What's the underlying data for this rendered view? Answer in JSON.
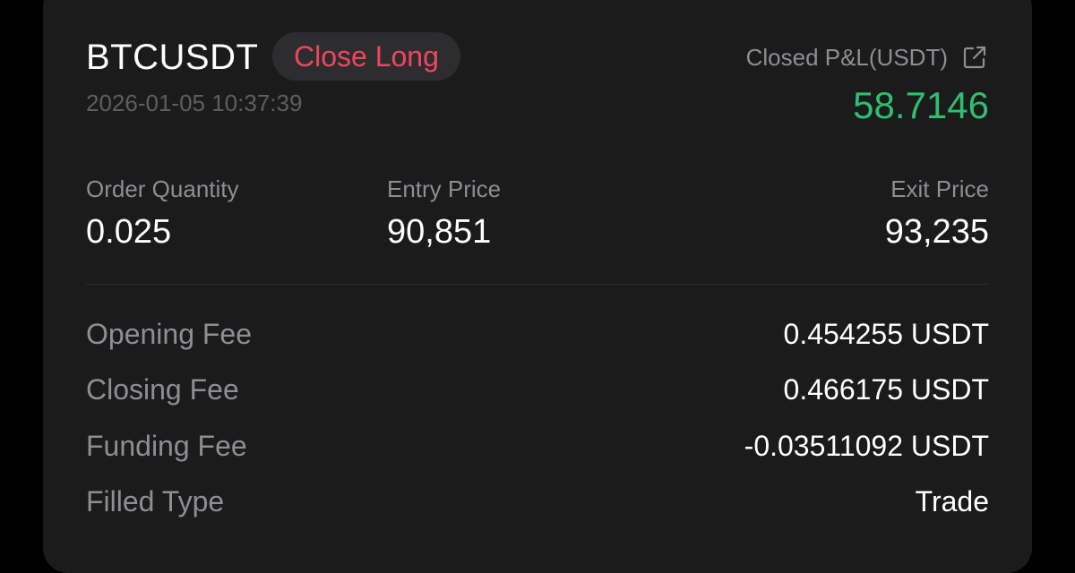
{
  "header": {
    "symbol": "BTCUSDT",
    "action_badge": "Close Long",
    "timestamp": "2026-01-05 10:37:39",
    "pnl_label": "Closed P&L(USDT)",
    "pnl_value": "58.7146",
    "external_link_icon": "external-link-icon"
  },
  "stats": {
    "order_quantity": {
      "label": "Order Quantity",
      "value": "0.025"
    },
    "entry_price": {
      "label": "Entry Price",
      "value": "90,851"
    },
    "exit_price": {
      "label": "Exit Price",
      "value": "93,235"
    }
  },
  "details": [
    {
      "label": "Opening Fee",
      "value": "0.454255 USDT"
    },
    {
      "label": "Closing Fee",
      "value": "0.466175 USDT"
    },
    {
      "label": "Funding Fee",
      "value": "-0.03511092 USDT"
    },
    {
      "label": "Filled Type",
      "value": "Trade"
    }
  ],
  "colors": {
    "background": "#000000",
    "card": "#1b1b1c",
    "badge_text": "#f0455e",
    "profit": "#2fbf71",
    "muted": "#8e8e93"
  }
}
